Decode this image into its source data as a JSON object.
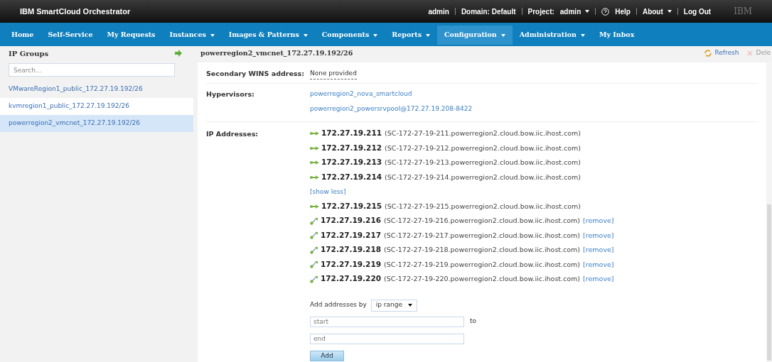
{
  "header": {
    "title": "IBM SmartCloud Orchestrator",
    "user": "admin",
    "domain": "Domain: Default",
    "project_label": "Project:",
    "project": "admin",
    "help": "Help",
    "about": "About",
    "logout": "Log Out",
    "logo": "IBM"
  },
  "nav": [
    {
      "label": "Home",
      "dropdown": false,
      "selected": false
    },
    {
      "label": "Self-Service",
      "dropdown": false,
      "selected": false
    },
    {
      "label": "My Requests",
      "dropdown": false,
      "selected": false
    },
    {
      "label": "Instances",
      "dropdown": true,
      "selected": false
    },
    {
      "label": "Images & Patterns",
      "dropdown": true,
      "selected": false
    },
    {
      "label": "Components",
      "dropdown": true,
      "selected": false
    },
    {
      "label": "Reports",
      "dropdown": true,
      "selected": false
    },
    {
      "label": "Configuration",
      "dropdown": true,
      "selected": true
    },
    {
      "label": "Administration",
      "dropdown": true,
      "selected": false
    },
    {
      "label": "My Inbox",
      "dropdown": false,
      "selected": false
    }
  ],
  "sidebar": {
    "title": "IP Groups",
    "search_placeholder": "Search...",
    "items": [
      {
        "label": "VMwareRegion1_public_172.27.19.192/26",
        "selected": false
      },
      {
        "label": "kvmregion1_public_172.27.19.192/26",
        "selected": false
      },
      {
        "label": "powerregion2_vmcnet_172.27.19.192/26",
        "selected": true
      }
    ]
  },
  "detail": {
    "title": "powerregion2_vmcnet_172.27.19.192/26",
    "actions": [
      {
        "label": "Refresh",
        "disabled": false
      },
      {
        "label": "Dele",
        "disabled": true
      }
    ],
    "wins": {
      "label": "Secondary WINS address:",
      "value": "None provided"
    },
    "hypervisors": {
      "label": "Hypervisors:",
      "items": [
        "powerregion2_nova_smartcloud",
        "powerregion2_powersrvpool@172.27.19.208-8422"
      ]
    },
    "ip_label": "IP Addresses:",
    "addresses_top": [
      {
        "kind": "fixed",
        "ip": "172.27.19.211",
        "host": "(SC-172-27-19-211.powerregion2.cloud.bow.iic.ihost.com)"
      },
      {
        "kind": "fixed",
        "ip": "172.27.19.212",
        "host": "(SC-172-27-19-212.powerregion2.cloud.bow.iic.ihost.com)"
      },
      {
        "kind": "fixed",
        "ip": "172.27.19.213",
        "host": "(SC-172-27-19-213.powerregion2.cloud.bow.iic.ihost.com)"
      },
      {
        "kind": "fixed",
        "ip": "172.27.19.214",
        "host": "(SC-172-27-19-214.powerregion2.cloud.bow.iic.ihost.com)"
      }
    ],
    "show_less": "[show less]",
    "addresses_bottom": [
      {
        "kind": "fixed",
        "ip": "172.27.19.215",
        "host": "(SC-172-27-19-215.powerregion2.cloud.bow.iic.ihost.com)"
      },
      {
        "kind": "removable",
        "ip": "172.27.19.216",
        "host": "(SC-172-27-19-216.powerregion2.cloud.bow.iic.ihost.com)",
        "remove": "[remove]"
      },
      {
        "kind": "removable",
        "ip": "172.27.19.217",
        "host": "(SC-172-27-19-217.powerregion2.cloud.bow.iic.ihost.com)",
        "remove": "[remove]"
      },
      {
        "kind": "removable",
        "ip": "172.27.19.218",
        "host": "(SC-172-27-19-218.powerregion2.cloud.bow.iic.ihost.com)",
        "remove": "[remove]"
      },
      {
        "kind": "removable",
        "ip": "172.27.19.219",
        "host": "(SC-172-27-19-219.powerregion2.cloud.bow.iic.ihost.com)",
        "remove": "[remove]"
      },
      {
        "kind": "removable",
        "ip": "172.27.19.220",
        "host": "(SC-172-27-19-220.powerregion2.cloud.bow.iic.ihost.com)",
        "remove": "[remove]"
      }
    ],
    "add": {
      "label": "Add addresses by",
      "method": "ip range",
      "start_placeholder": "start",
      "to": "to",
      "end_placeholder": "end",
      "button": "Add"
    }
  }
}
